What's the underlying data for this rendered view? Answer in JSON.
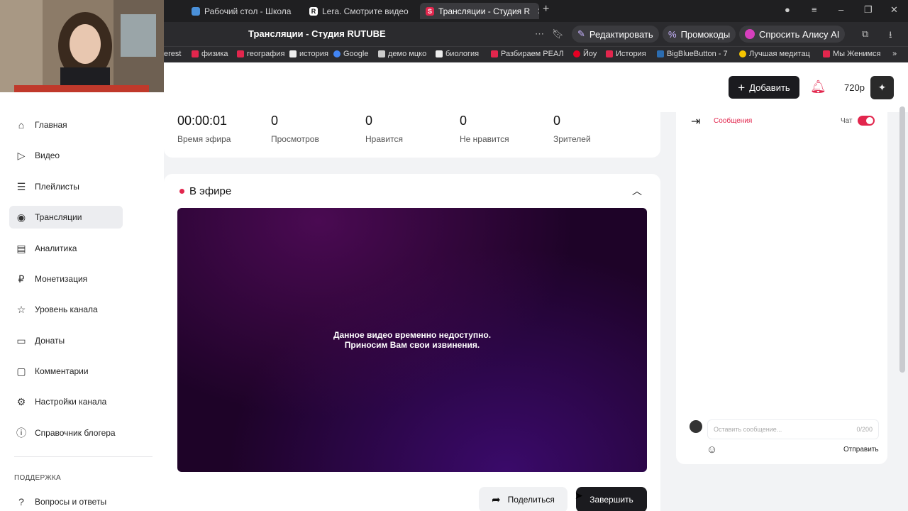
{
  "browser": {
    "tabs": [
      {
        "label": "Рабочий стол - Школа Би"
      },
      {
        "label": "Lera. Смотрите видео он"
      },
      {
        "label": "Трансляции - Студия R",
        "active": true
      }
    ],
    "page_title": "Трансляции - Студия RUTUBE",
    "actions": {
      "edit": "Редактировать",
      "promo": "Промокоды",
      "alice": "Спросить Алису AI"
    },
    "bookmarks": [
      "erest",
      "физика",
      "география",
      "история",
      "Google",
      "демо мцко",
      "биология",
      "Разбираем РЕАЛ",
      "Йоу",
      "История",
      "BigBlueButton - 7",
      "Лучшая медитац",
      "Мы Женимся"
    ]
  },
  "header": {
    "add_label": "Добавить",
    "quality": "720р"
  },
  "sidebar": {
    "items": [
      {
        "label": "Главная",
        "icon": "home-icon"
      },
      {
        "label": "Видео",
        "icon": "video-icon"
      },
      {
        "label": "Плейлисты",
        "icon": "playlist-icon"
      },
      {
        "label": "Трансляции",
        "icon": "broadcast-icon",
        "active": true
      },
      {
        "label": "Аналитика",
        "icon": "chart-icon"
      },
      {
        "label": "Монетизация",
        "icon": "ruble-icon"
      },
      {
        "label": "Уровень канала",
        "icon": "star-icon"
      },
      {
        "label": "Донаты",
        "icon": "donate-icon"
      },
      {
        "label": "Комментарии",
        "icon": "comment-icon"
      },
      {
        "label": "Настройки канала",
        "icon": "gear-icon"
      },
      {
        "label": "Справочник блогера",
        "icon": "info-icon"
      }
    ],
    "support_heading": "ПОДДЕРЖКА",
    "support_items": [
      {
        "label": "Вопросы и ответы",
        "icon": "help-icon"
      }
    ]
  },
  "stats": [
    {
      "value": "00:00:01",
      "label": "Время эфира"
    },
    {
      "value": "0",
      "label": "Просмотров"
    },
    {
      "value": "0",
      "label": "Нравится"
    },
    {
      "value": "0",
      "label": "Не нравится"
    },
    {
      "value": "0",
      "label": "Зрителей"
    }
  ],
  "live": {
    "title": "В эфире",
    "player_message_line1": "Данное видео временно недоступно.",
    "player_message_line2": "Приносим Вам свои извинения.",
    "share_label": "Поделиться",
    "finish_label": "Завершить"
  },
  "chat": {
    "tab_label": "Сообщения",
    "chat_toggle_label": "Чат",
    "input_placeholder": "Оставить сообщение...",
    "char_count": "0/200",
    "send_label": "Отправить"
  },
  "colors": {
    "accent": "#e2264d",
    "dark_button": "#1b1b1f"
  }
}
